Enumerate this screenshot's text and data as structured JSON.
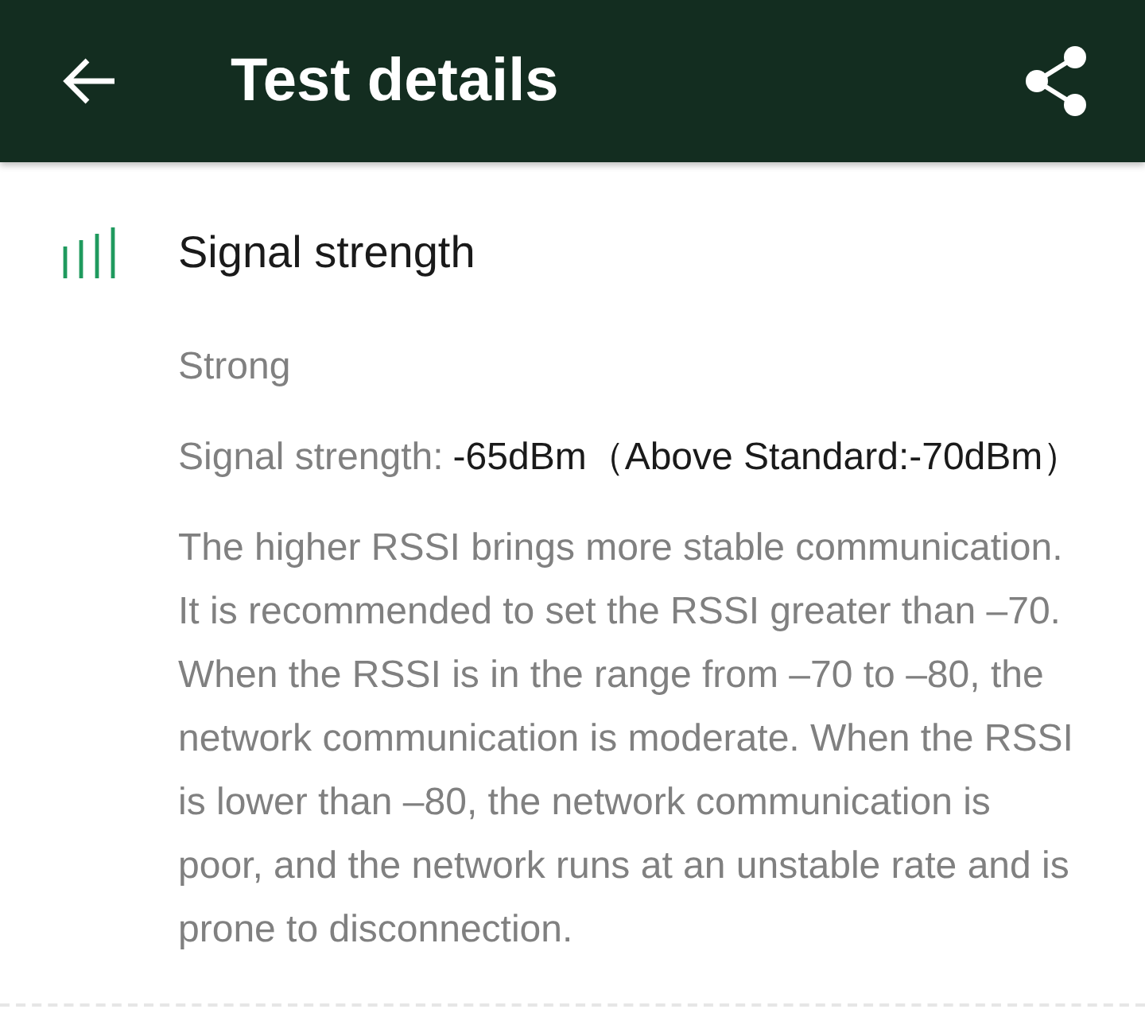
{
  "app_bar": {
    "title": "Test details"
  },
  "section": {
    "title": "Signal strength",
    "status": "Strong",
    "reading_label": "Signal strength:",
    "reading_value": "-65dBm（Above Standard:-70dBm）",
    "description": "The higher RSSI brings more stable communication. It is recommended to set the RSSI greater than –70. When the RSSI is in the range from –70 to –80, the network communication is moderate. When the RSSI is lower than –80, the network communication is poor, and the network runs at an unstable rate and is prone to disconnection."
  }
}
